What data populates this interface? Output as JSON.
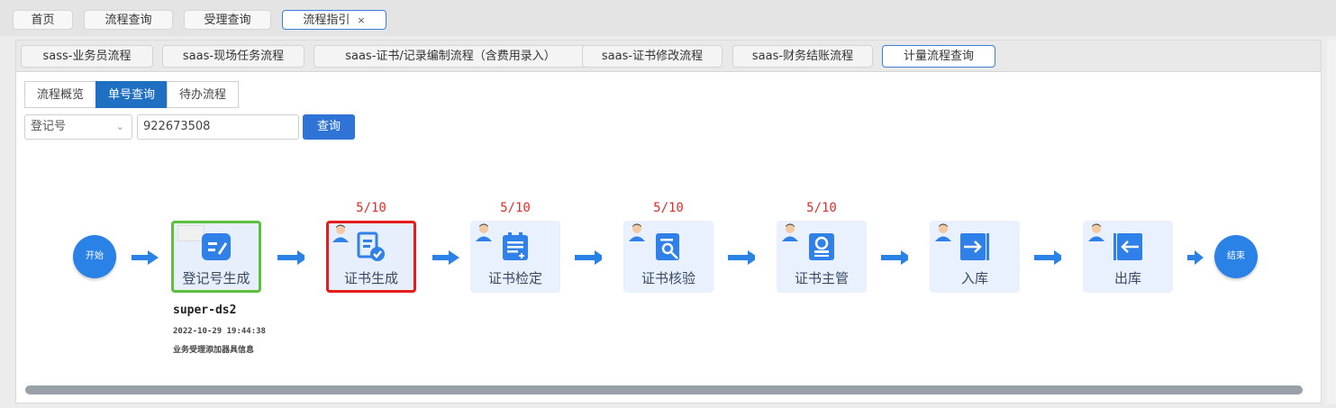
{
  "top_tabs": [
    "首页",
    "流程查询",
    "受理查询",
    "流程指引"
  ],
  "top_tab_close": "×",
  "sub_tabs": [
    "sass-业务员流程",
    "saas-现场任务流程",
    "saas-证书/记录编制流程（含费用录入）",
    "saas-证书修改流程",
    "saas-财务结账流程",
    "计量流程查询"
  ],
  "segments": [
    "流程概览",
    "单号查询",
    "待办流程"
  ],
  "search": {
    "field_label": "登记号",
    "value": "922673508",
    "button": "查询"
  },
  "flow": {
    "start": "开始",
    "end": "结束",
    "nodes": [
      {
        "label": "登记号生成",
        "count": "",
        "state": "done",
        "icon": "edit-doc-icon"
      },
      {
        "label": "证书生成",
        "count": "5/10",
        "state": "current",
        "icon": "cert-check-icon"
      },
      {
        "label": "证书检定",
        "count": "5/10",
        "state": "pending",
        "icon": "clipboard-add-icon"
      },
      {
        "label": "证书核验",
        "count": "5/10",
        "state": "pending",
        "icon": "doc-search-icon"
      },
      {
        "label": "证书主管",
        "count": "5/10",
        "state": "pending",
        "icon": "stamp-icon"
      },
      {
        "label": "入库",
        "count": "",
        "state": "pending",
        "icon": "inbound-icon"
      },
      {
        "label": "出库",
        "count": "",
        "state": "pending",
        "icon": "outbound-icon"
      }
    ],
    "done_info": {
      "user": "super-ds2",
      "time": "2022-10-29 19:44:38",
      "note": "业务受理添加器具信息"
    }
  },
  "colors": {
    "accent": "#2f73d6",
    "node_bg": "#e8f1fd",
    "done_border": "#5cbf3d",
    "current_border": "#e41c1c",
    "count": "#e02b2b"
  }
}
